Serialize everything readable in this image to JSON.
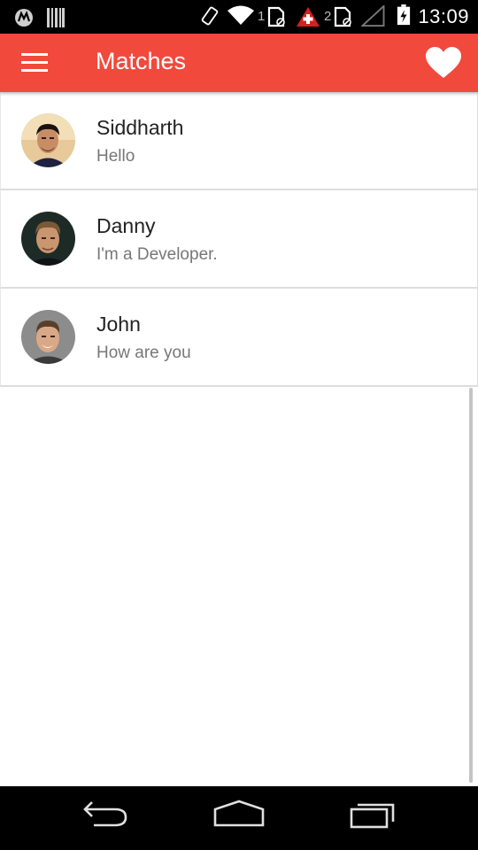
{
  "status_bar": {
    "time": "13:09",
    "sim1_label": "1",
    "sim2_label": "2",
    "icons": [
      "motorola-icon",
      "barcode-icon",
      "vibrate-icon",
      "wifi-icon",
      "sim1-icon",
      "alert-icon",
      "sim2-icon",
      "signal-icon",
      "battery-icon"
    ]
  },
  "app_bar": {
    "title": "Matches",
    "background_color": "#F2493D",
    "menu_icon": "hamburger-menu-icon",
    "action_icon": "heart-icon"
  },
  "matches": [
    {
      "name": "Siddharth",
      "message": "Hello",
      "avatar": "avatar-siddharth"
    },
    {
      "name": "Danny",
      "message": "I'm a Developer.",
      "avatar": "avatar-danny"
    },
    {
      "name": "John",
      "message": "How are you",
      "avatar": "avatar-john"
    }
  ],
  "nav_bar": {
    "icons": [
      "back-icon",
      "home-icon",
      "recent-apps-icon"
    ]
  }
}
